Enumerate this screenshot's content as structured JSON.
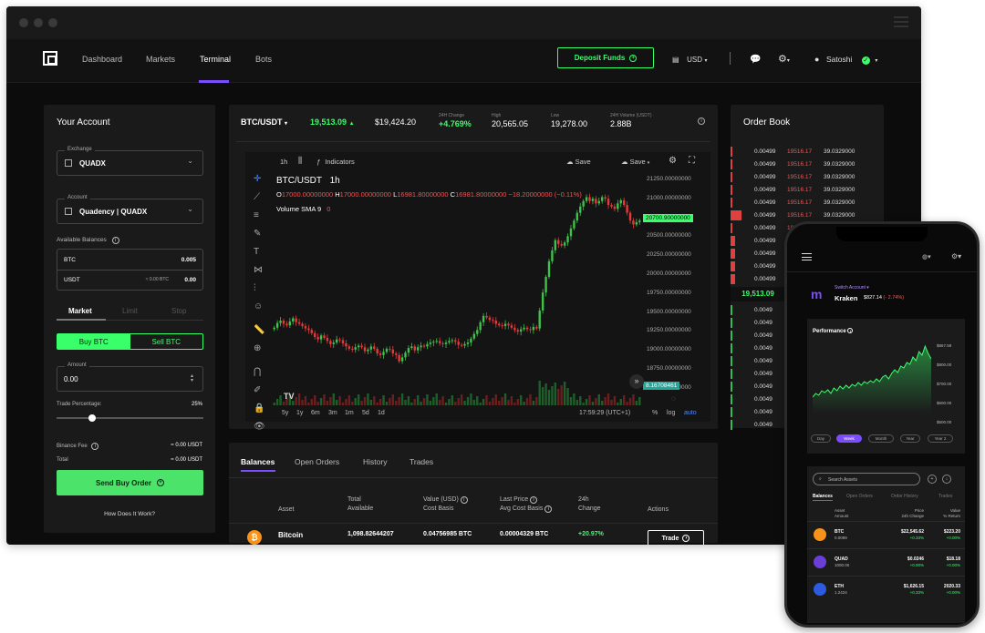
{
  "nav": {
    "links": [
      "Dashboard",
      "Markets",
      "Terminal",
      "Bots"
    ],
    "deposit_label": "Deposit Funds",
    "currency": "USD",
    "user": "Satoshi"
  },
  "account": {
    "title": "Your Account",
    "exchange_label": "Exchange",
    "exchange_value": "QUADX",
    "account_label": "Account",
    "account_value": "Quadency | QUADX",
    "available_label": "Available Balances",
    "balances": [
      {
        "asset": "BTC",
        "note": "",
        "value": "0.005"
      },
      {
        "asset": "USDT",
        "note": "≈ 0.00 BTC",
        "value": "0.00"
      }
    ],
    "order_types": [
      "Market",
      "Limit",
      "Stop"
    ],
    "buy_label": "Buy BTC",
    "sell_label": "Sell BTC",
    "amount_label": "Amount",
    "amount_value": "0.00",
    "trade_pct_label": "Trade Percentage:",
    "trade_pct_value": "25%",
    "trade_pct_fraction": 0.25,
    "fee_label": "Binance Fee",
    "fee_value": "≈ 0.00 USDT",
    "total_label": "Total",
    "total_value": "≈ 0.00 USDT",
    "send_label": "Send Buy Order",
    "how_label": "How Does It Work?"
  },
  "ticker": {
    "pair": "BTC/USDT",
    "price": "19,513.09",
    "usd_price": "$19,424.20",
    "change_label": "24H Change",
    "change_value": "+4.769%",
    "high_label": "High",
    "high_value": "20,565.05",
    "low_label": "Low",
    "low_value": "19,278.00",
    "vol_label": "24H Volume (USDT)",
    "vol_value": "2.88B"
  },
  "tv": {
    "interval": "1h",
    "indicators_label": "Indicators",
    "save_label": "Save",
    "legend_pair": "BTC/USDT",
    "legend_interval": "1h",
    "o_label": "O",
    "o_value": "17000.00000000",
    "h_label": "H",
    "h_value": "17000.00000000",
    "l_label": "L",
    "l_value": "16981.80000000",
    "c_label": "C",
    "c_value": "16981.80000000",
    "delta": "−18.20000000 (−0.11%)",
    "volume_label": "Volume SMA 9",
    "volume_value": "0",
    "price_axis": [
      "21250.00000000",
      "21000.00000000",
      "20750.00000000",
      "20500.00000000",
      "20250.00000000",
      "20000.00000000",
      "19750.00000000",
      "19500.00000000",
      "19250.00000000",
      "19000.00000000",
      "18750.00000000",
      "18500.00000000"
    ],
    "last_price_tag": "20700.90000000",
    "volume_tag": "8.16708461",
    "ranges": [
      "5y",
      "1y",
      "6m",
      "3m",
      "1m",
      "5d",
      "1d"
    ],
    "time": "17:59:29 (UTC+1)",
    "pct": "%",
    "log": "log",
    "auto": "auto",
    "logo": "TV"
  },
  "orders": {
    "tabs": [
      "Balances",
      "Open Orders",
      "History",
      "Trades"
    ],
    "headers": {
      "asset": "Asset",
      "total_1": "Total",
      "total_2": "Available",
      "value_1": "Value (USD)",
      "value_2": "Cost Basis",
      "last_1": "Last Price",
      "last_2": "Avg Cost Basis",
      "change_1": "24h",
      "change_2": "Change",
      "actions": "Actions"
    },
    "row": {
      "asset": "Bitcoin",
      "total": "1,098.82644207",
      "value": "0.04756985 BTC",
      "last": "0.00004329 BTC",
      "change": "+20.97%",
      "trade_label": "Trade"
    }
  },
  "orderbook": {
    "title": "Order Book",
    "asks": [
      {
        "amount": "0.00499",
        "price": "19516.17",
        "total": "39.0329000"
      },
      {
        "amount": "0.00499",
        "price": "19516.17",
        "total": "39.0329000"
      },
      {
        "amount": "0.00499",
        "price": "19516.17",
        "total": "39.0329000"
      },
      {
        "amount": "0.00499",
        "price": "19516.17",
        "total": "39.0329000"
      },
      {
        "amount": "0.00499",
        "price": "19516.17",
        "total": "39.0329000"
      },
      {
        "amount": "0.00499",
        "price": "19516.17",
        "total": "39.0329000"
      },
      {
        "amount": "0.00499",
        "price": "19516.17",
        "total": "39.0329000"
      },
      {
        "amount": "0.00499",
        "price": "",
        "total": ""
      },
      {
        "amount": "0.00499",
        "price": "",
        "total": ""
      },
      {
        "amount": "0.00499",
        "price": "",
        "total": ""
      },
      {
        "amount": "0.00499",
        "price": "",
        "total": ""
      }
    ],
    "mid_price": "19,513.09",
    "bids": [
      "0.0049",
      "0.0049",
      "0.0049",
      "0.0049",
      "0.0049",
      "0.0049",
      "0.0049",
      "0.0049",
      "0.0049",
      "0.0049"
    ]
  },
  "phone": {
    "switch_label": "Switch Account",
    "exchange": "Kraken",
    "balance": "$827.14",
    "balance_change": "(- 2.74%)",
    "perf_label": "Performance",
    "perf_axis": [
      "$867.59",
      "$800.00",
      "$700.00",
      "$600.00",
      "$500.00"
    ],
    "periods": [
      "Day",
      "Week",
      "Month",
      "Year",
      "Year 2"
    ],
    "search_placeholder": "Search Assets",
    "tabs": [
      "Balances",
      "Open Orders",
      "Order History",
      "Trades"
    ],
    "col_asset_1": "Asset",
    "col_asset_2": "Amount",
    "col_price_1": "Price",
    "col_price_2": "24h Change",
    "col_value_1": "Value",
    "col_value_2": "% Return",
    "rows": [
      {
        "asset": "BTC",
        "amount": "0.0099",
        "price": "$22,545.62",
        "change": "+0.33%",
        "value": "$223.20",
        "ret": "+0.00%",
        "color": "#f7931a"
      },
      {
        "asset": "QUAD",
        "amount": "1000.00",
        "price": "$0.0246",
        "change": "+0.00%",
        "value": "$18.18",
        "ret": "+0.00%",
        "color": "#6b3fd6"
      },
      {
        "asset": "ETH",
        "amount": "1.2424",
        "price": "$1,626.15",
        "change": "+0.33%",
        "value": "2020.33",
        "ret": "+0.00%",
        "color": "#2c5be0"
      }
    ]
  },
  "chart_data": {
    "type": "candlestick",
    "ylim": [
      18500,
      21250
    ],
    "closes": [
      19330,
      19390,
      19420,
      19380,
      19360,
      19410,
      19450,
      19400,
      19380,
      19350,
      19320,
      19300,
      19260,
      19210,
      19180,
      19230,
      19200,
      19160,
      19120,
      19140,
      19180,
      19170,
      19130,
      19090,
      19060,
      19050,
      19080,
      19100,
      19080,
      19030,
      19050,
      19090,
      19060,
      19000,
      18980,
      19020,
      19060,
      19050,
      19000,
      18980,
      18900,
      18950,
      19010,
      19070,
      19090,
      19040,
      19080,
      19100,
      19090,
      19120,
      19140,
      19150,
      19160,
      19130,
      19120,
      19140,
      19160,
      19170,
      19150,
      19110,
      19100,
      19120,
      19140,
      19190,
      19250,
      19300,
      19400,
      19480,
      19460,
      19430,
      19420,
      19380,
      19360,
      19350,
      19380,
      19360,
      19330,
      19300,
      19280,
      19310,
      19330,
      19310,
      19300,
      19340,
      19320,
      19550,
      19780,
      19980,
      20180,
      20320,
      20450,
      20400,
      20380,
      20420,
      20500,
      20600,
      20700,
      20800,
      20880,
      20950,
      21000,
      20950,
      20980,
      20920,
      20950,
      21000,
      20980,
      20900,
      20880,
      20850,
      20920,
      20960,
      20900,
      20800,
      20700,
      20650,
      20680,
      20700
    ]
  }
}
